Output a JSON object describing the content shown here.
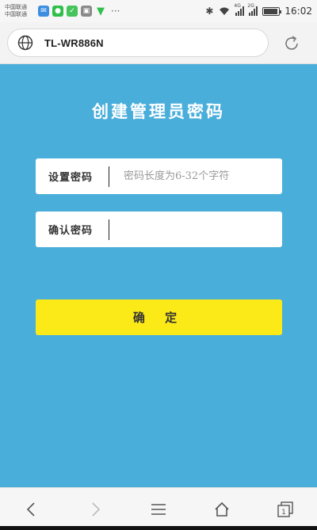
{
  "status_bar": {
    "carrier_line1": "中国联通",
    "carrier_line2": "中国联通",
    "net_1": "4G",
    "net_2": "2G",
    "time": "16:02",
    "battery_level": 0.9
  },
  "browser": {
    "url": "TL-WR886N",
    "icons": {
      "site": "globe-icon",
      "reload": "reload-icon"
    }
  },
  "form": {
    "title": "创建管理员密码",
    "set_password_label": "设置密码",
    "set_password_placeholder": "密码长度为6-32个字符",
    "set_password_value": "",
    "confirm_password_label": "确认密码",
    "confirm_password_placeholder": "",
    "confirm_password_value": "",
    "confirm_button": "确 定"
  },
  "nav": {
    "back": "back-icon",
    "forward": "forward-icon",
    "menu": "menu-icon",
    "home": "home-icon",
    "tabs": "tabs-icon",
    "tab_count": "1"
  },
  "colors": {
    "background": "#4aaedb",
    "button": "#fbe918",
    "field": "#ffffff"
  }
}
